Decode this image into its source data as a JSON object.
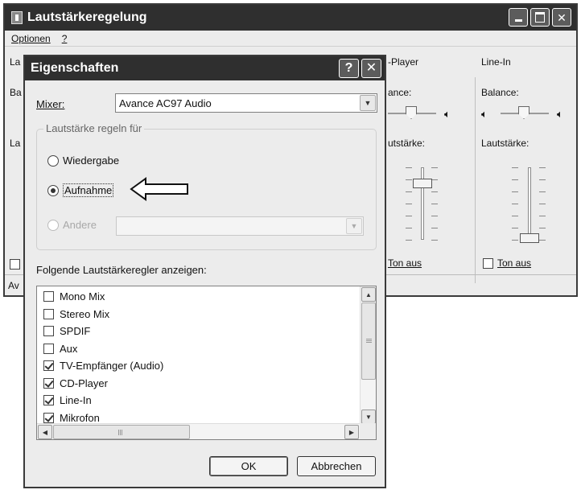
{
  "main_window": {
    "title": "Lautstärkeregelung",
    "menu": {
      "options": "Optionen",
      "help": "?"
    },
    "columns": [
      {
        "header": "La",
        "balance": "Ba",
        "volume": "La",
        "mute": ""
      },
      {
        "header": "-Player",
        "balance": "ance:",
        "volume": "utstärke:",
        "mute": "Ton aus",
        "mute_checked": false
      },
      {
        "header": "Line-In",
        "balance": "Balance:",
        "volume": "Lautstärke:",
        "mute": "Ton aus",
        "mute_checked": false
      }
    ],
    "status": "Av"
  },
  "dialog": {
    "title": "Eigenschaften",
    "mixer_label": "Mixer:",
    "mixer_value": "Avance AC97 Audio",
    "group_legend": "Lautstärke regeln für",
    "radio_playback": "Wiedergabe",
    "radio_recording": "Aufnahme",
    "radio_other": "Andere",
    "selected_radio": "Aufnahme",
    "list_caption": "Folgende Lautstärkeregler anzeigen:",
    "list_items": [
      {
        "label": "Mono Mix",
        "checked": false
      },
      {
        "label": "Stereo Mix",
        "checked": false
      },
      {
        "label": "SPDIF",
        "checked": false
      },
      {
        "label": "Aux",
        "checked": false
      },
      {
        "label": "TV-Empfänger (Audio)",
        "checked": true
      },
      {
        "label": "CD-Player",
        "checked": true
      },
      {
        "label": "Line-In",
        "checked": true
      },
      {
        "label": "Mikrofon",
        "checked": true
      }
    ],
    "ok_label": "OK",
    "cancel_label": "Abbrechen"
  },
  "icons": [
    "app-icon",
    "minimize-icon",
    "maximize-icon",
    "close-icon",
    "help-icon",
    "chevron-down-icon",
    "speaker-left-icon",
    "speaker-right-icon",
    "pointer-arrow-icon"
  ]
}
